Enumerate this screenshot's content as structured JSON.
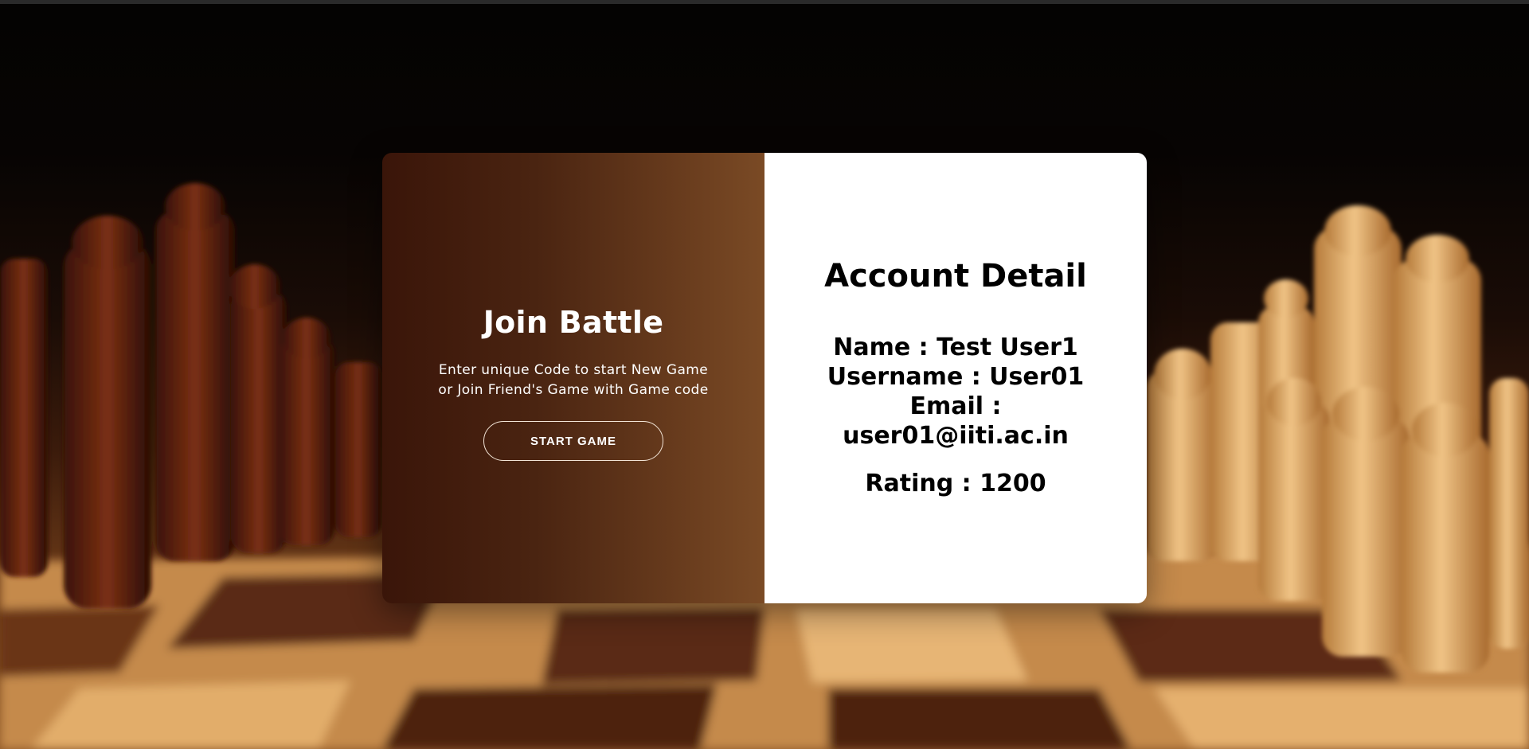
{
  "join": {
    "title": "Join Battle",
    "description_line1": "Enter unique Code to start New Game",
    "description_line2": "or Join Friend's Game with Game code",
    "start_button": "START GAME"
  },
  "account": {
    "title": "Account Detail",
    "name": "Name : Test User1",
    "username": "Username : User01",
    "email_label": "Email :",
    "email_value": "user01@iiti.ac.in",
    "rating": "Rating : 1200"
  },
  "colors": {
    "left_panel_start": "#3a1509",
    "left_panel_end": "#7a4a25",
    "right_panel": "#ffffff",
    "background_dark": "#040302"
  }
}
